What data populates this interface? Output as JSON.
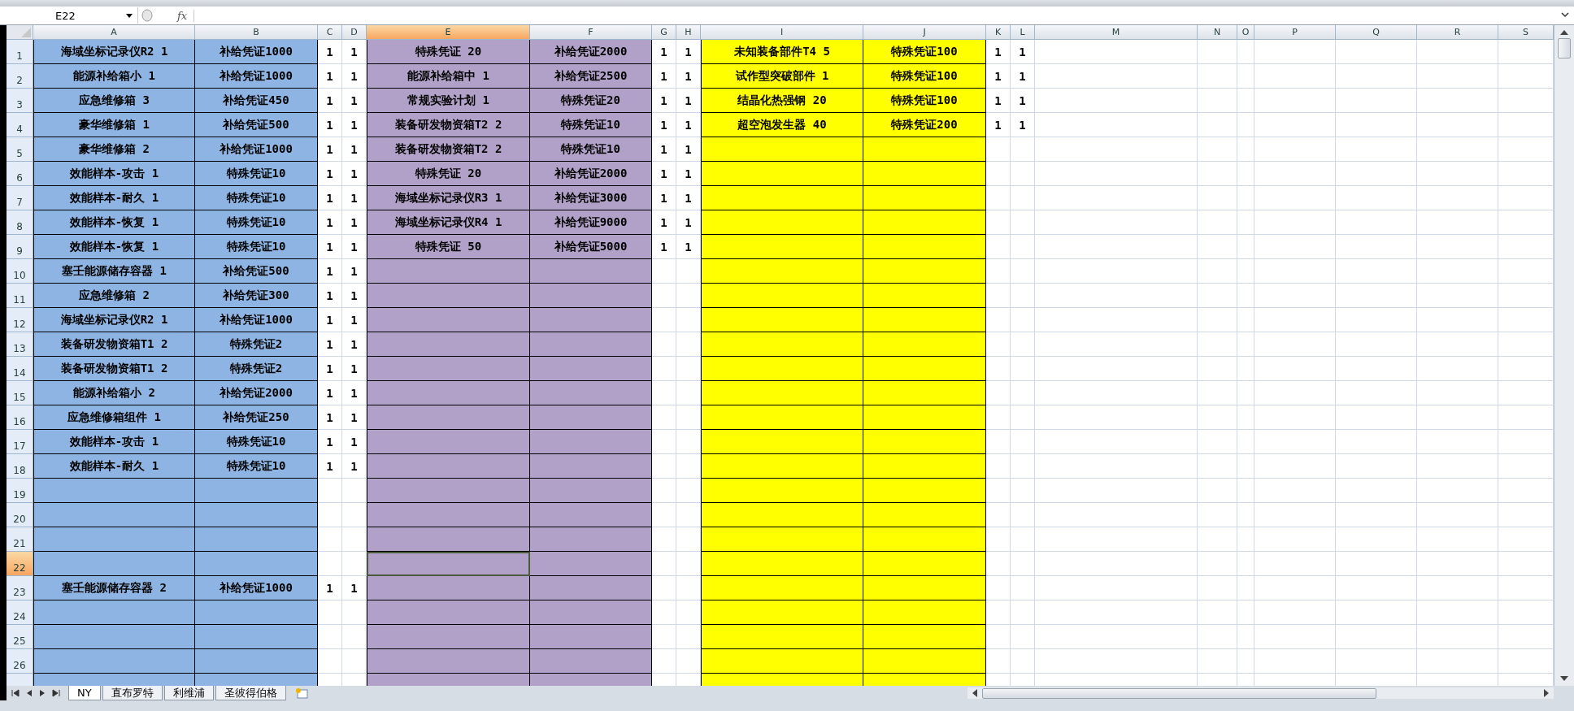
{
  "formula_bar": {
    "name_box": "E22",
    "function_label": "fx"
  },
  "columns": [
    {
      "letter": "A",
      "color": "#8db4e2",
      "selected": false
    },
    {
      "letter": "B",
      "color": "#8db4e2",
      "selected": false
    },
    {
      "letter": "C",
      "selected": false
    },
    {
      "letter": "D",
      "selected": false
    },
    {
      "letter": "E",
      "color": "#b1a0c7",
      "selected": true
    },
    {
      "letter": "F",
      "color": "#b1a0c7",
      "selected": false
    },
    {
      "letter": "G",
      "selected": false
    },
    {
      "letter": "H",
      "selected": false
    },
    {
      "letter": "I",
      "color": "#ffff00",
      "selected": false
    },
    {
      "letter": "J",
      "color": "#ffff00",
      "selected": false
    },
    {
      "letter": "K",
      "selected": false
    },
    {
      "letter": "L",
      "selected": false
    },
    {
      "letter": "M",
      "selected": false
    },
    {
      "letter": "N",
      "selected": false
    },
    {
      "letter": "O",
      "selected": false
    },
    {
      "letter": "P",
      "selected": false
    },
    {
      "letter": "Q",
      "selected": false
    },
    {
      "letter": "R",
      "selected": false
    },
    {
      "letter": "S",
      "selected": false
    }
  ],
  "rows": [
    {
      "number": "1",
      "selected": false,
      "cells": {
        "A": "海域坐标记录仪R2 1",
        "B": "补给凭证1000",
        "C": "1",
        "D": "1",
        "E": "特殊凭证 20",
        "F": "补给凭证2000",
        "G": "1",
        "H": "1",
        "I": "未知装备部件T4 5",
        "J": "特殊凭证100",
        "K": "1",
        "L": "1"
      }
    },
    {
      "number": "2",
      "selected": false,
      "cells": {
        "A": "能源补给箱小 1",
        "B": "补给凭证1000",
        "C": "1",
        "D": "1",
        "E": "能源补给箱中 1",
        "F": "补给凭证2500",
        "G": "1",
        "H": "1",
        "I": "试作型突破部件 1",
        "J": "特殊凭证100",
        "K": "1",
        "L": "1"
      }
    },
    {
      "number": "3",
      "selected": false,
      "cells": {
        "A": "应急维修箱 3",
        "B": "补给凭证450",
        "C": "1",
        "D": "1",
        "E": "常规实验计划 1",
        "F": "特殊凭证20",
        "G": "1",
        "H": "1",
        "I": "结晶化热强钢 20",
        "J": "特殊凭证100",
        "K": "1",
        "L": "1"
      }
    },
    {
      "number": "4",
      "selected": false,
      "cells": {
        "A": "豪华维修箱 1",
        "B": "补给凭证500",
        "C": "1",
        "D": "1",
        "E": "装备研发物资箱T2 2",
        "F": "特殊凭证10",
        "G": "1",
        "H": "1",
        "I": "超空泡发生器 40",
        "J": "特殊凭证200",
        "K": "1",
        "L": "1"
      }
    },
    {
      "number": "5",
      "selected": false,
      "cells": {
        "A": "豪华维修箱 2",
        "B": "补给凭证1000",
        "C": "1",
        "D": "1",
        "E": "装备研发物资箱T2 2",
        "F": "特殊凭证10",
        "G": "1",
        "H": "1"
      }
    },
    {
      "number": "6",
      "selected": false,
      "cells": {
        "A": "效能样本-攻击 1",
        "B": "特殊凭证10",
        "C": "1",
        "D": "1",
        "E": "特殊凭证 20",
        "F": "补给凭证2000",
        "G": "1",
        "H": "1"
      }
    },
    {
      "number": "7",
      "selected": false,
      "cells": {
        "A": "效能样本-耐久 1",
        "B": "特殊凭证10",
        "C": "1",
        "D": "1",
        "E": "海域坐标记录仪R3 1",
        "F": "补给凭证3000",
        "G": "1",
        "H": "1"
      }
    },
    {
      "number": "8",
      "selected": false,
      "cells": {
        "A": "效能样本-恢复 1",
        "B": "特殊凭证10",
        "C": "1",
        "D": "1",
        "E": "海域坐标记录仪R4 1",
        "F": "补给凭证9000",
        "G": "1",
        "H": "1"
      }
    },
    {
      "number": "9",
      "selected": false,
      "cells": {
        "A": "效能样本-恢复 1",
        "B": "特殊凭证10",
        "C": "1",
        "D": "1",
        "E": "特殊凭证 50",
        "F": "补给凭证5000",
        "G": "1",
        "H": "1"
      }
    },
    {
      "number": "10",
      "selected": false,
      "cells": {
        "A": "塞壬能源储存容器 1",
        "B": "补给凭证500",
        "C": "1",
        "D": "1"
      }
    },
    {
      "number": "11",
      "selected": false,
      "cells": {
        "A": "应急维修箱 2",
        "B": "补给凭证300",
        "C": "1",
        "D": "1"
      }
    },
    {
      "number": "12",
      "selected": false,
      "cells": {
        "A": "海域坐标记录仪R2 1",
        "B": "补给凭证1000",
        "C": "1",
        "D": "1"
      }
    },
    {
      "number": "13",
      "selected": false,
      "cells": {
        "A": "装备研发物资箱T1 2",
        "B": "特殊凭证2",
        "C": "1",
        "D": "1"
      }
    },
    {
      "number": "14",
      "selected": false,
      "cells": {
        "A": "装备研发物资箱T1 2",
        "B": "特殊凭证2",
        "C": "1",
        "D": "1"
      }
    },
    {
      "number": "15",
      "selected": false,
      "cells": {
        "A": "能源补给箱小 2",
        "B": "补给凭证2000",
        "C": "1",
        "D": "1"
      }
    },
    {
      "number": "16",
      "selected": false,
      "cells": {
        "A": "应急维修箱组件 1",
        "B": "补给凭证250",
        "C": "1",
        "D": "1"
      }
    },
    {
      "number": "17",
      "selected": false,
      "cells": {
        "A": "效能样本-攻击 1",
        "B": "特殊凭证10",
        "C": "1",
        "D": "1"
      }
    },
    {
      "number": "18",
      "selected": false,
      "cells": {
        "A": "效能样本-耐久 1",
        "B": "特殊凭证10",
        "C": "1",
        "D": "1"
      }
    },
    {
      "number": "19",
      "selected": false,
      "cells": {}
    },
    {
      "number": "20",
      "selected": false,
      "cells": {}
    },
    {
      "number": "21",
      "selected": false,
      "cells": {}
    },
    {
      "number": "22",
      "selected": true,
      "cells": {}
    },
    {
      "number": "23",
      "selected": false,
      "cells": {
        "A": "塞壬能源储存容器 2",
        "B": "补给凭证1000",
        "C": "1",
        "D": "1"
      }
    },
    {
      "number": "24",
      "selected": false,
      "cells": {}
    },
    {
      "number": "25",
      "selected": false,
      "cells": {}
    },
    {
      "number": "26",
      "selected": false,
      "cells": {}
    }
  ],
  "sheet_tabs": [
    {
      "label": "NY",
      "selected": true
    },
    {
      "label": "直布罗特",
      "selected": false
    },
    {
      "label": "利维浦",
      "selected": false
    },
    {
      "label": "圣彼得伯格",
      "selected": false
    }
  ]
}
